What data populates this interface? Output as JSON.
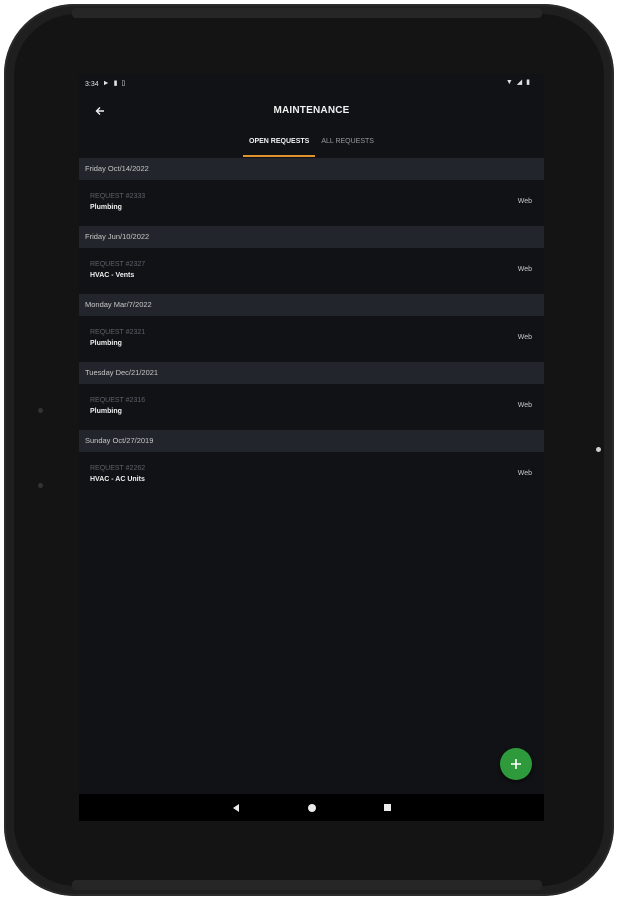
{
  "status_bar": {
    "time": "3:34"
  },
  "app_bar": {
    "title": "MAINTENANCE"
  },
  "tabs": [
    {
      "label": "OPEN REQUESTS",
      "active": true
    },
    {
      "label": "ALL REQUESTS",
      "active": false
    }
  ],
  "groups": [
    {
      "date": "Friday Oct/14/2022",
      "request": {
        "number": "REQUEST #2333",
        "category": "Plumbing",
        "source": "Web"
      }
    },
    {
      "date": "Friday Jun/10/2022",
      "request": {
        "number": "REQUEST #2327",
        "category": "HVAC - Vents",
        "source": "Web"
      }
    },
    {
      "date": "Monday Mar/7/2022",
      "request": {
        "number": "REQUEST #2321",
        "category": "Plumbing",
        "source": "Web"
      }
    },
    {
      "date": "Tuesday Dec/21/2021",
      "request": {
        "number": "REQUEST #2316",
        "category": "Plumbing",
        "source": "Web"
      }
    },
    {
      "date": "Sunday Oct/27/2019",
      "request": {
        "number": "REQUEST #2262",
        "category": "HVAC - AC Units",
        "source": "Web"
      }
    }
  ],
  "fab": {
    "icon": "plus-icon",
    "color": "#2e9a3b"
  },
  "colors": {
    "accent": "#e0922f",
    "background": "#101215",
    "header": "#22252b"
  }
}
